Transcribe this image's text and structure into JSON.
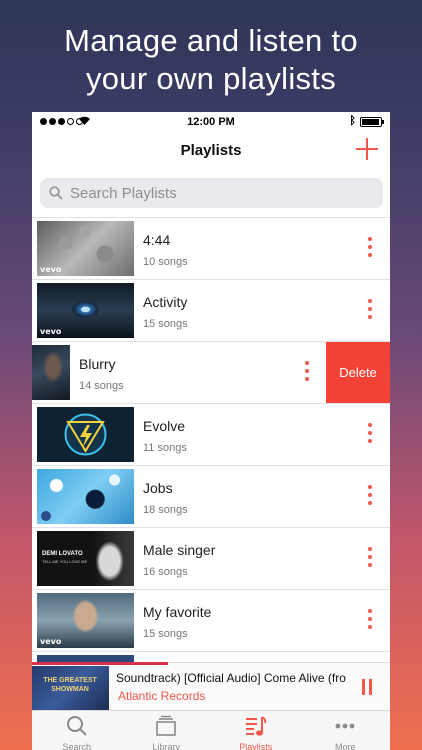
{
  "headline": [
    "Manage and listen to",
    "your own playlists"
  ],
  "status_bar": {
    "time": "12:00 PM"
  },
  "nav": {
    "title": "Playlists"
  },
  "search": {
    "placeholder": "Search Playlists"
  },
  "playlists": [
    {
      "name": "4:44",
      "count": "10 songs",
      "thumb": "gray-texture",
      "badge": "vevo"
    },
    {
      "name": "Activity",
      "count": "15 songs",
      "thumb": "blue-eye",
      "badge": "vevo"
    },
    {
      "name": "Blurry",
      "count": "14 songs",
      "thumb": "dark-portrait",
      "swiped": true,
      "delete_label": "Delete"
    },
    {
      "name": "Evolve",
      "count": "11 songs",
      "thumb": "lightning-triangle"
    },
    {
      "name": "Jobs",
      "count": "18 songs",
      "thumb": "blue-paint"
    },
    {
      "name": "Male singer",
      "count": "16 songs",
      "thumb": "demi-lovato",
      "thumb_text": [
        "DEMI LOVATO",
        "TELL ME YOU LOVE ME"
      ]
    },
    {
      "name": "My favorite",
      "count": "15 songs",
      "thumb": "singer-portrait",
      "badge": "vevo"
    }
  ],
  "now_playing": {
    "track": "Soundtrack) [Official Audio]   Come Alive (fro",
    "artist": "Atlantic Records",
    "progress": 0.38,
    "art_text": "THE GREATEST SHOWMAN"
  },
  "tabs": [
    {
      "label": "Search",
      "icon": "search-icon"
    },
    {
      "label": "Library",
      "icon": "library-icon"
    },
    {
      "label": "Playlists",
      "icon": "playlists-icon",
      "active": true
    },
    {
      "label": "More",
      "icon": "more-icon"
    }
  ],
  "colors": {
    "accent": "#f2574a",
    "delete": "#f44336"
  }
}
